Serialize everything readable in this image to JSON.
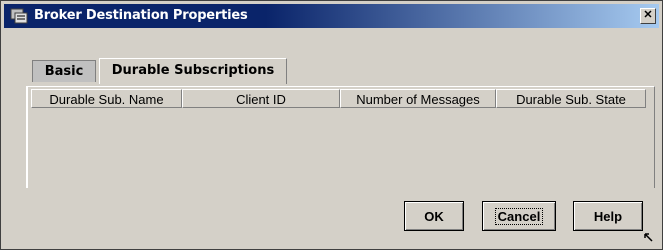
{
  "window": {
    "title": "Broker Destination Properties",
    "close_glyph": "✕"
  },
  "tabs": [
    {
      "label": "Basic",
      "selected": false
    },
    {
      "label": "Durable Subscriptions",
      "selected": true
    }
  ],
  "table": {
    "columns": [
      "Durable Sub. Name",
      "Client ID",
      "Number of Messages",
      "Durable Sub. State"
    ],
    "rows": []
  },
  "buttons": {
    "ok": "OK",
    "cancel": "Cancel",
    "help": "Help"
  },
  "icons": {
    "title": "properties-icon",
    "close": "close-icon",
    "resize": "resize-grip-icon"
  }
}
